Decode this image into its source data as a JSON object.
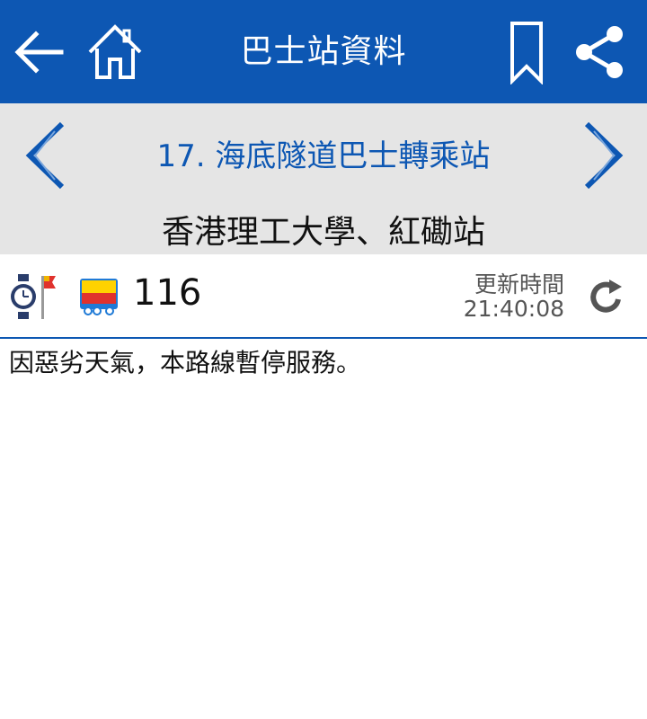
{
  "appbar": {
    "title": "巴士站資料",
    "icons": [
      "back-arrow-icon",
      "home-icon",
      "bookmark-icon",
      "share-icon"
    ]
  },
  "stop": {
    "station": "17. 海底隧道巴士轉乘站",
    "name": "香港理工大學、紅磡站",
    "icons": [
      "chevron-left-icon",
      "chevron-right-icon"
    ]
  },
  "route": {
    "number": "116",
    "update_label": "更新時間",
    "update_time": "21:40:08",
    "icons": [
      "watch-flag-icon",
      "bus-company-icon",
      "refresh-icon"
    ]
  },
  "message": "因惡劣天氣，本路線暫停服務。",
  "colors": {
    "primary": "#0d57b3",
    "stopbar_bg": "#e5e5e5",
    "text": "#111111"
  }
}
